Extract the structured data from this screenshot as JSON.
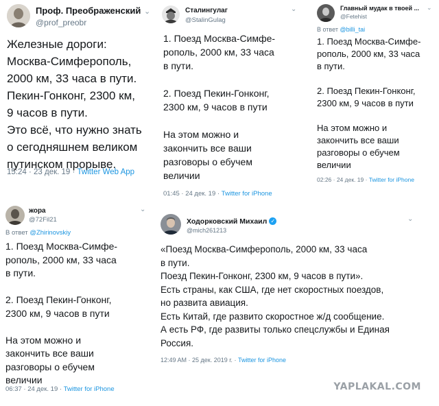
{
  "tweets": [
    {
      "name": "Проф. Преображенский",
      "handle": "@prof_preobr",
      "body": [
        "Железные дороги:",
        "Москва-Симферополь,",
        "2000 км, 33 часа в пути.",
        "Пекин-Гонконг, 2300 км,",
        "9 часов в пути.",
        "Это всё, что нужно знать",
        "о сегодняшнем великом",
        "путинском прорыве."
      ],
      "time": "15:24 · 23 дек. 19 ·",
      "app": "Twitter Web App"
    },
    {
      "name": "Сталингулаг",
      "handle": "@StalinGulag",
      "body": [
        "1. Поезд Москва-Симфе-",
        "рополь, 2000 км, 33 часа",
        "в пути.",
        "",
        "2. Поезд Пекин-Гонконг,",
        "2300 км, 9 часов в пути",
        "",
        "На этом можно и",
        "закончить все ваши",
        "разговоры о ебучем",
        "величии"
      ],
      "time": "01:45 · 24 дек. 19 ·",
      "app": "Twitter for iPhone"
    },
    {
      "name": "Главный мудак в твоей ...",
      "handle": "@Fetehist",
      "reply_prefix": "В ответ",
      "reply_to": "@billi_tai",
      "body": [
        "1. Поезд Москва-Симфе-",
        "рополь, 2000 км, 33 часа",
        "в пути.",
        "",
        "2. Поезд Пекин-Гонконг,",
        "2300 км, 9 часов в пути",
        "",
        "На этом можно и",
        "закончить все ваши",
        "разговоры о ебучем",
        "величии"
      ],
      "time": "02:26 · 24 дек. 19 ·",
      "app": "Twitter for iPhone"
    },
    {
      "name": "жора",
      "handle": "@72Fil21",
      "reply_prefix": "В ответ",
      "reply_to": "@Zhirinovskiy",
      "body": [
        "1. Поезд Москва-Симфе-",
        "рополь, 2000 км, 33 часа",
        "в пути.",
        "",
        "2. Поезд Пекин-Гонконг,",
        "2300 км, 9 часов в пути",
        "",
        "На этом можно и",
        "закончить все ваши",
        "разговоры о ебучем",
        "величии"
      ],
      "time": "06:37 · 24 дек. 19 ·",
      "app": "Twitter for iPhone"
    },
    {
      "name": "Ходорковский Михаил",
      "handle": "@mich261213",
      "body": [
        "«Поезд Москва-Симферополь, 2000 км, 33 часа",
        "в пути.",
        "Поезд Пекин-Гонконг, 2300 км, 9 часов в пути».",
        "Есть страны, как США, где нет скоростных поездов,",
        "но развита авиация.",
        "Есть Китай, где развито скоростное ж/д сообщение.",
        "А есть РФ, где развиты только спецслужбы и Единая",
        "Россия."
      ],
      "time": "12:49 AM · 25 дек. 2019 г. ·",
      "app": "Twitter for iPhone"
    }
  ],
  "watermark": "YAPLAKAL.COM",
  "colors": {
    "link": "#1b95e0",
    "muted": "#657786",
    "text": "#14171a",
    "verified": "#1da1f2"
  }
}
